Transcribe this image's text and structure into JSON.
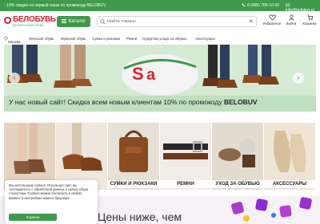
{
  "topbar": {
    "promo": "- 10% скидка на первый заказ по промокоду BELOBUV",
    "phone": "8 (495) 789-10-55",
    "email": "info@belobuv.ru"
  },
  "header": {
    "logo_brand": "БЕЛОБУВЬ",
    "logo_tagline": "БЕЛОРУССКАЯ ОБУВЬ",
    "catalog_label": "Каталог",
    "search_placeholder": "Найти товары",
    "icons": [
      {
        "label": "Избранное",
        "icon": "heart-icon"
      },
      {
        "label": "Войти",
        "icon": "user-icon"
      },
      {
        "label": "Корзина",
        "icon": "cart-icon"
      }
    ]
  },
  "nav": {
    "city": "Москва",
    "items": [
      "Женская обувь",
      "Мужская обувь",
      "Сумки и рюкзаки",
      "Ремни",
      "Средства ухода за обувью",
      "Аксессуары"
    ]
  },
  "hero": {
    "title_prefix": "У нас новый сайт! Скидка всем новым клиентам 10% по промокоду ",
    "title_code": "BELOBUV"
  },
  "categories": [
    {
      "label": "",
      "color": "#e8d9c8"
    },
    {
      "label": "",
      "color": "#efe6dc"
    },
    {
      "label": "СУМКИ И РЮКЗАКИ",
      "color": "#e7e1d8"
    },
    {
      "label": "РЕМНИ",
      "color": "#f1ece6"
    },
    {
      "label": "УХОД ЗА ОБУВЬЮ",
      "color": "#e3dbcf"
    },
    {
      "label": "АКСЕССУАРЫ",
      "color": "#efe5d6"
    }
  ],
  "promo_strip": {
    "text": "Цены ниже, чем"
  },
  "cookie": {
    "text": "Мы используем cookies. Используя сайт, вы соглашаетесь с обработкой данных о целью сбора статистики. Cookies можно отключить в любой момент в настройках вашего браузера",
    "button": "Хорошо"
  },
  "colors": {
    "brand_green": "#3f9a4b",
    "brand_red": "#d9232d"
  }
}
